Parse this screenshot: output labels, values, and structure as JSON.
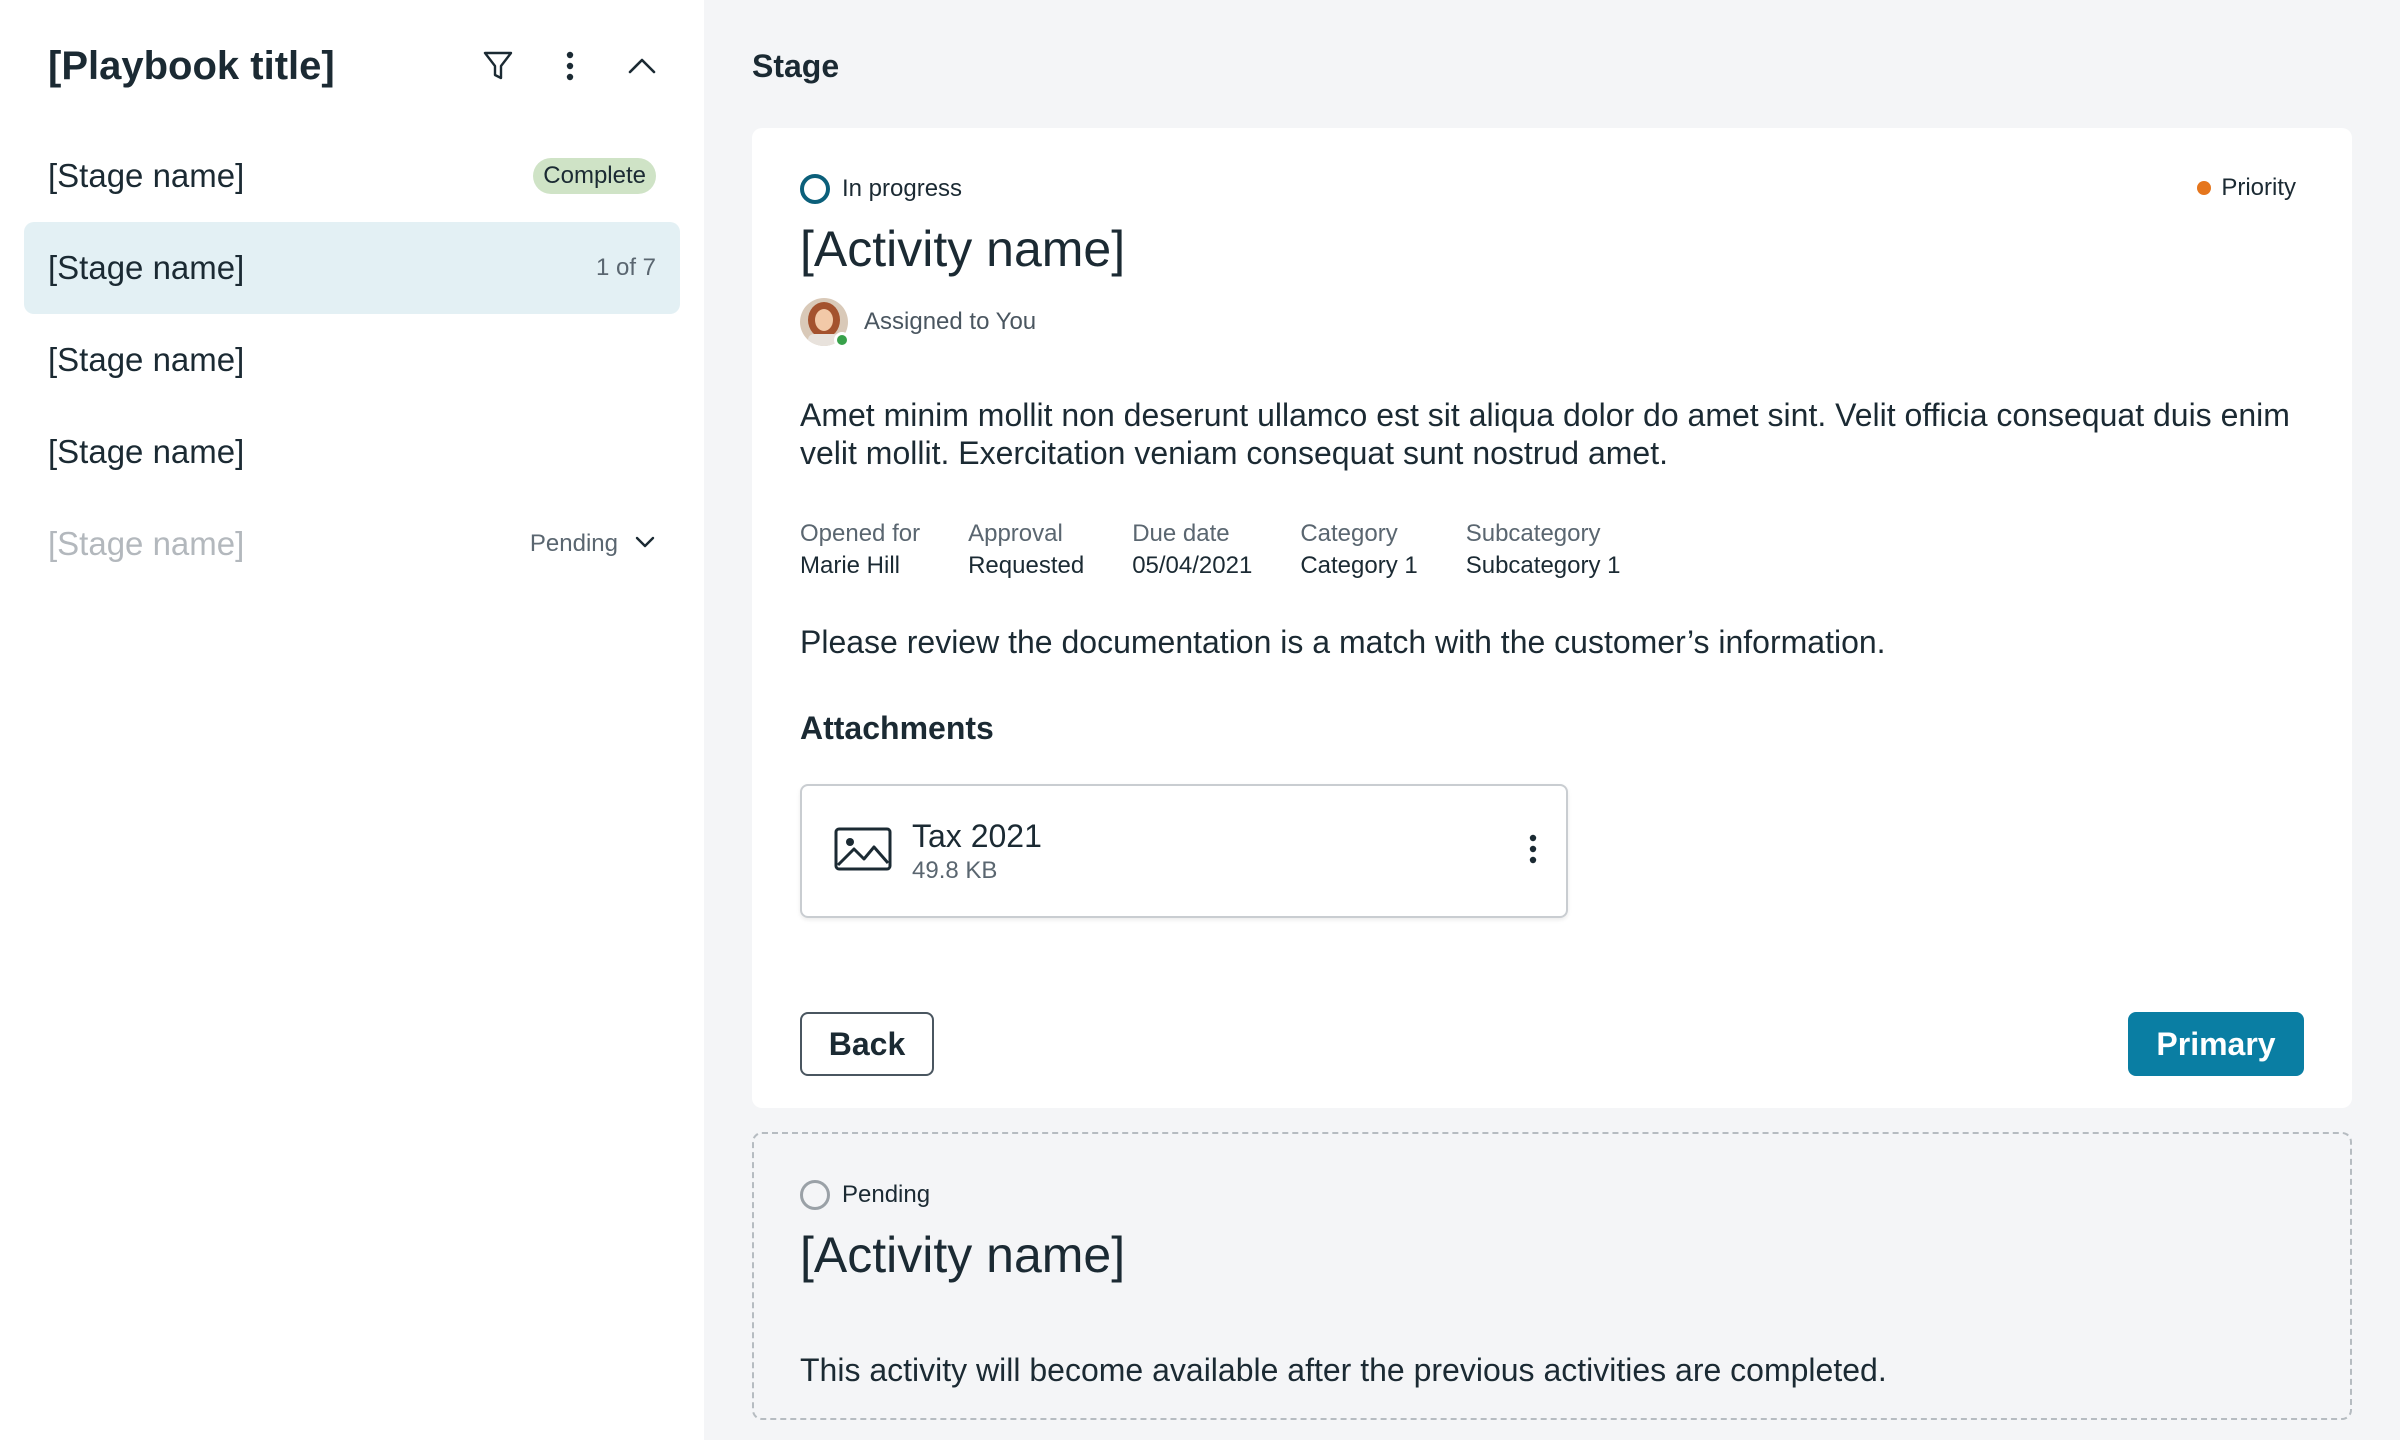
{
  "sidebar": {
    "title": "[Playbook title]",
    "icons": {
      "filter": "filter-icon",
      "more": "more-vertical-icon",
      "collapse": "chevron-up-icon"
    },
    "stages": [
      {
        "name": "[Stage name]",
        "badge": "Complete"
      },
      {
        "name": "[Stage name]",
        "meta": "1 of 7"
      },
      {
        "name": "[Stage name]"
      },
      {
        "name": "[Stage name]"
      },
      {
        "name": "[Stage name]",
        "meta": "Pending"
      }
    ]
  },
  "main": {
    "title": "Stage",
    "activity": {
      "status": "In progress",
      "priority": "Priority",
      "priority_color": "#e5761d",
      "name": "[Activity name]",
      "assigned": "Assigned to You",
      "description": "Amet minim mollit non deserunt ullamco est sit aliqua dolor do amet sint. Velit officia consequat duis enim velit mollit. Exercitation veniam consequat sunt nostrud amet.",
      "fields": [
        {
          "label": "Opened for",
          "value": "Marie Hill"
        },
        {
          "label": "Approval",
          "value": "Requested"
        },
        {
          "label": "Due date",
          "value": "05/04/2021"
        },
        {
          "label": "Category",
          "value": "Category 1"
        },
        {
          "label": "Subcategory",
          "value": "Subcategory 1"
        }
      ],
      "instruction": "Please review the documentation is a match with the customer’s information.",
      "attachments_heading": "Attachments",
      "attachment": {
        "name": "Tax 2021",
        "size": "49.8 KB",
        "icon": "image-icon"
      },
      "back_label": "Back",
      "primary_label": "Primary",
      "primary_color": "#0a7ea3"
    },
    "pending_activity": {
      "status": "Pending",
      "name": "[Activity name]",
      "description": "This activity will become available after the previous activities are completed."
    }
  }
}
